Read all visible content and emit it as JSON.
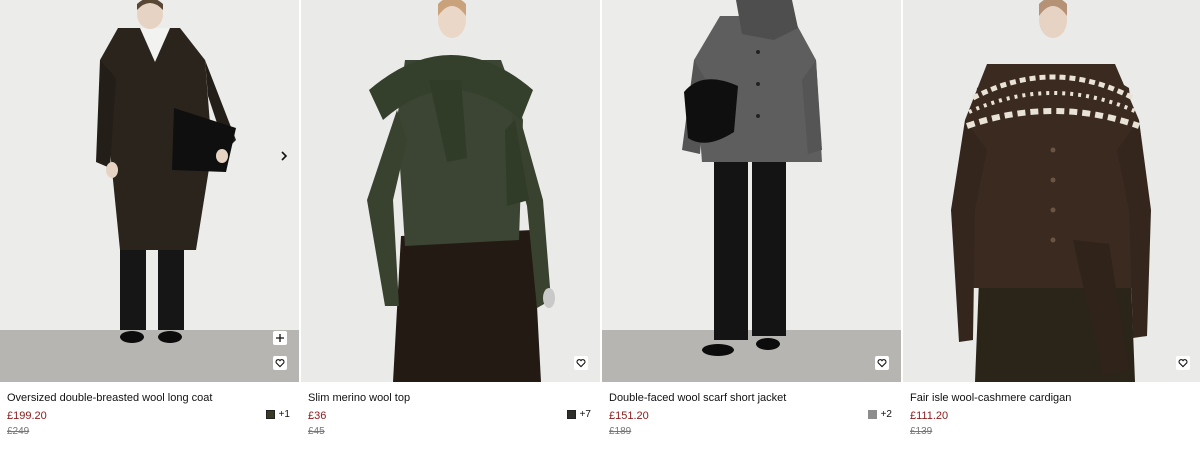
{
  "colors": {
    "sale_price": "#8b1a1a",
    "wall": "#ececea",
    "floor": "#b7b5b1"
  },
  "icons": {
    "next": "chevron-right-icon",
    "add": "plus-icon",
    "wishlist": "heart-icon"
  },
  "products": [
    {
      "name": "Oversized double-breasted wool long coat",
      "price": "£199.20",
      "was": "£249",
      "swatch_color": "#3a3a24",
      "more_colors": "+1"
    },
    {
      "name": "Slim merino wool top",
      "price": "£36",
      "was": "£45",
      "swatch_color": "#2d2d29",
      "more_colors": "+7"
    },
    {
      "name": "Double-faced wool scarf short jacket",
      "price": "£151.20",
      "was": "£189",
      "swatch_color": "#8c8c8c",
      "more_colors": "+2"
    },
    {
      "name": "Fair isle wool-cashmere cardigan",
      "price": "£111.20",
      "was": "£139",
      "swatch_color": "",
      "more_colors": ""
    }
  ]
}
